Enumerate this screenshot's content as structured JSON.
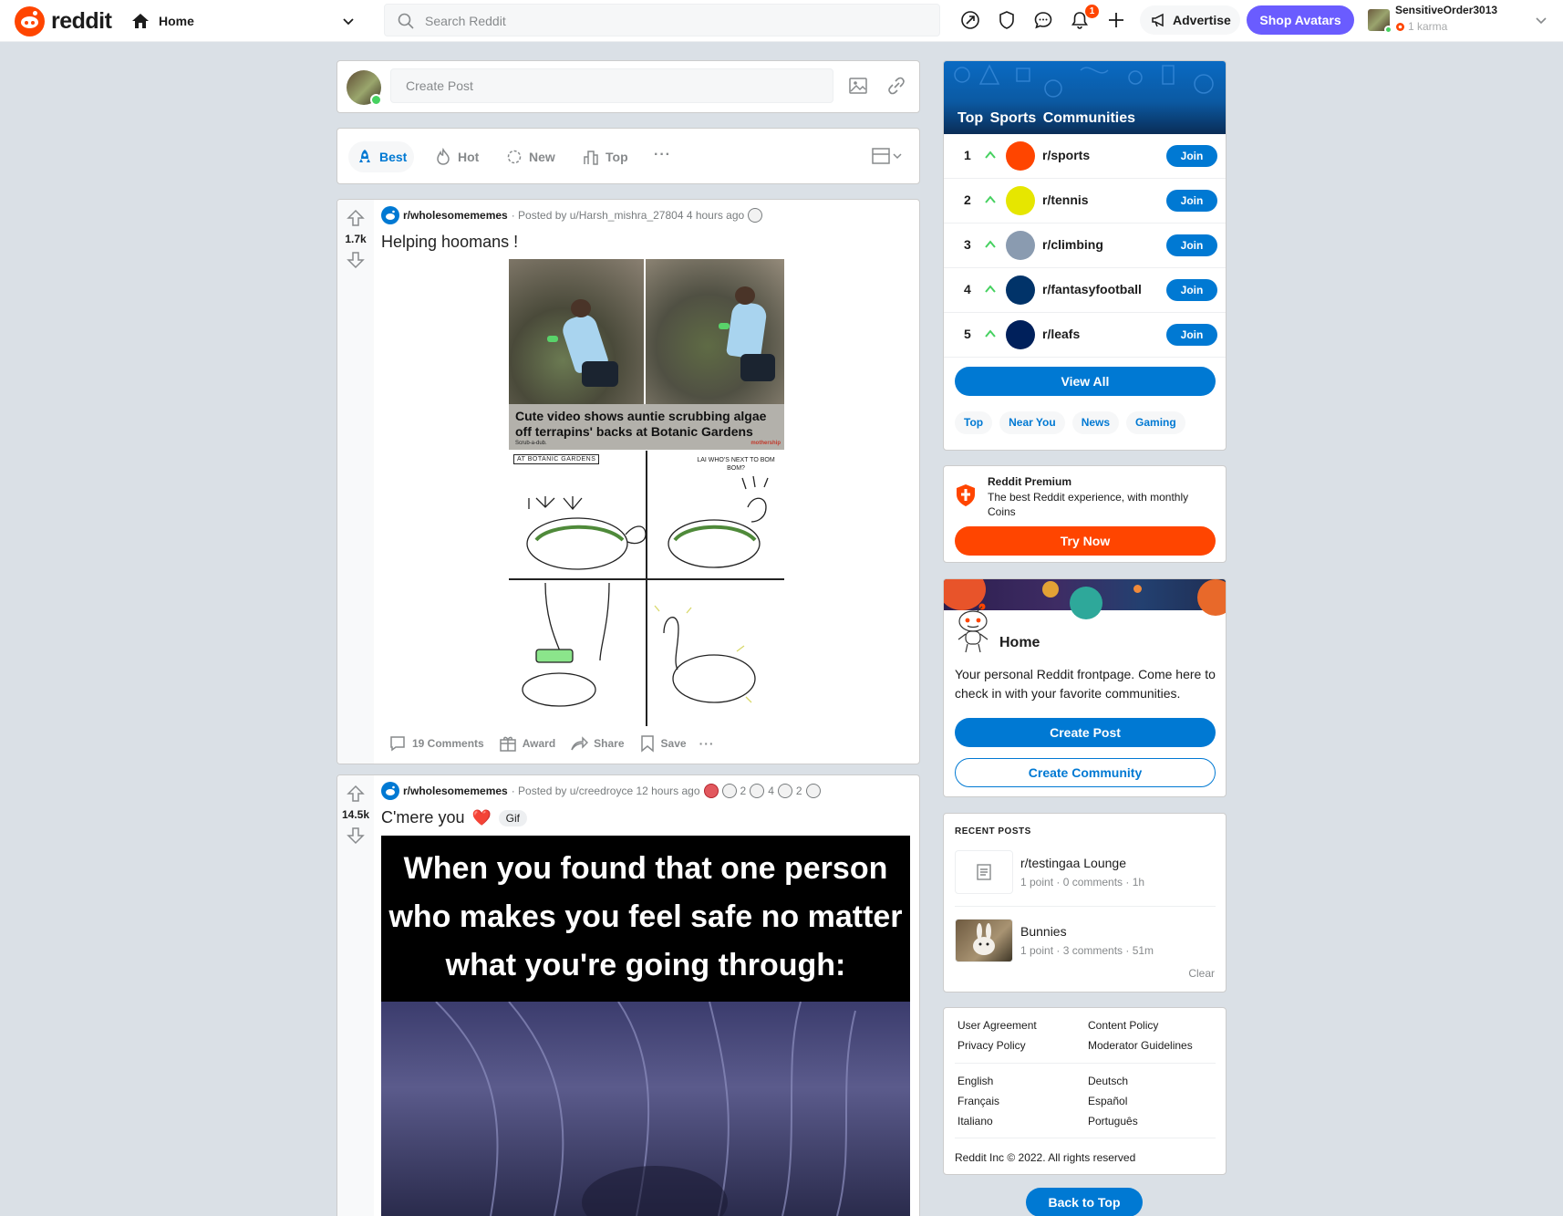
{
  "header": {
    "logo_text": "reddit",
    "feed_selector": "Home",
    "search_placeholder": "Search Reddit",
    "notifications_count": "1",
    "advertise_label": "Advertise",
    "shop_label": "Shop Avatars",
    "username": "SensitiveOrder3013",
    "karma": "1 karma"
  },
  "create_post": {
    "placeholder": "Create Post"
  },
  "sort": {
    "tabs": [
      {
        "label": "Best",
        "active": true
      },
      {
        "label": "Hot",
        "active": false
      },
      {
        "label": "New",
        "active": false
      },
      {
        "label": "Top",
        "active": false
      }
    ],
    "more": "···"
  },
  "posts": [
    {
      "votes": "1.7k",
      "subreddit": "r/wholesomememes",
      "posted_by": "· Posted by u/Harsh_mishra_27804 4 hours ago",
      "title": "Helping hoomans !",
      "image": {
        "headline": "Cute video shows auntie scrubbing algae off terrapins' backs at Botanic Gardens",
        "foot": "Scrub-a-dub.",
        "brand": "mothership",
        "caption": "AT BOTANIC GARDENS",
        "speech": "LAI WHO'S NEXT TO BOM BOM?"
      },
      "comments": "19 Comments",
      "award": "Award",
      "share": "Share",
      "save": "Save"
    },
    {
      "votes": "14.5k",
      "subreddit": "r/wholesomememes",
      "posted_by": "· Posted by u/creedroyce 12 hours ago",
      "awards": [
        "2",
        "4",
        "2"
      ],
      "title": "C'mere you",
      "title_emoji": "❤️",
      "flair": "Gif",
      "meme_text": "When you found that one person who makes you feel safe no matter what you're going through:"
    }
  ],
  "top_communities": {
    "title": "Top  Sports  Communities",
    "items": [
      {
        "rank": "1",
        "name": "r/sports",
        "join": "Join",
        "color": "#ff4500"
      },
      {
        "rank": "2",
        "name": "r/tennis",
        "join": "Join",
        "color": "#e6e600"
      },
      {
        "rank": "3",
        "name": "r/climbing",
        "join": "Join",
        "color": "#8a9bb0"
      },
      {
        "rank": "4",
        "name": "r/fantasyfootball",
        "join": "Join",
        "color": "#013369"
      },
      {
        "rank": "5",
        "name": "r/leafs",
        "join": "Join",
        "color": "#00205b"
      }
    ],
    "view_all": "View All",
    "pills": [
      "Top",
      "Near You",
      "News",
      "Gaming"
    ]
  },
  "premium": {
    "title": "Reddit Premium",
    "desc": "The best Reddit experience, with monthly Coins",
    "cta": "Try Now"
  },
  "home_card": {
    "title": "Home",
    "desc": "Your personal Reddit frontpage. Come here to check in with your favorite communities.",
    "create_post": "Create Post",
    "create_community": "Create Community"
  },
  "recent_posts": {
    "heading": "RECENT POSTS",
    "items": [
      {
        "title": "r/testingaa Lounge",
        "meta": "1 point · 0 comments · 1h"
      },
      {
        "title": "Bunnies",
        "meta": "1 point · 3 comments · 51m"
      }
    ],
    "clear": "Clear"
  },
  "footer": {
    "links_left": [
      "User Agreement",
      "Privacy Policy"
    ],
    "links_right": [
      "Content Policy",
      "Moderator Guidelines"
    ],
    "langs_left": [
      "English",
      "Français",
      "Italiano"
    ],
    "langs_right": [
      "Deutsch",
      "Español",
      "Português"
    ],
    "copyright": "Reddit Inc © 2022. All rights reserved"
  },
  "back_to_top": "Back to Top",
  "colors": {
    "brand": "#ff4500",
    "accent_blue": "#0079d3",
    "shop_purple": "#6a5cff",
    "bg": "#dae0e6"
  }
}
